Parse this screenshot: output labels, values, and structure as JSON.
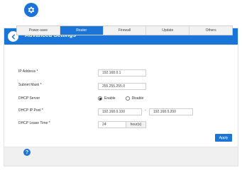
{
  "header": {
    "title": "Advanced Settings"
  },
  "tabs": [
    {
      "label": "Power-save",
      "active": false
    },
    {
      "label": "Router",
      "active": true
    },
    {
      "label": "Firewall",
      "active": false
    },
    {
      "label": "Update",
      "active": false
    },
    {
      "label": "Others",
      "active": false
    }
  ],
  "form": {
    "ip_address_label": "IP Address *",
    "ip_address_value": "192.168.0.1",
    "subnet_mask_label": "Subnet Mask *",
    "subnet_mask_value": "255.255.255.0",
    "dhcp_server_label": "DHCP Server",
    "dhcp_enable_label": "Enable",
    "dhcp_disable_label": "Disable",
    "dhcp_selected": "Enable",
    "dhcp_pool_label": "DHCP IP Pool *",
    "dhcp_pool_start": "192.168.0.100",
    "dhcp_pool_separator": "-",
    "dhcp_pool_end": "192.168.0.200",
    "lease_time_label": "DHCP Lease Time *",
    "lease_time_value": "24",
    "lease_time_unit": "hour(s)"
  },
  "apply_label": "Apply",
  "icons": {
    "top": "gear-icon",
    "back": "back-arrow-icon",
    "help": "help-icon"
  },
  "colors": {
    "accent": "#1b74d8"
  }
}
